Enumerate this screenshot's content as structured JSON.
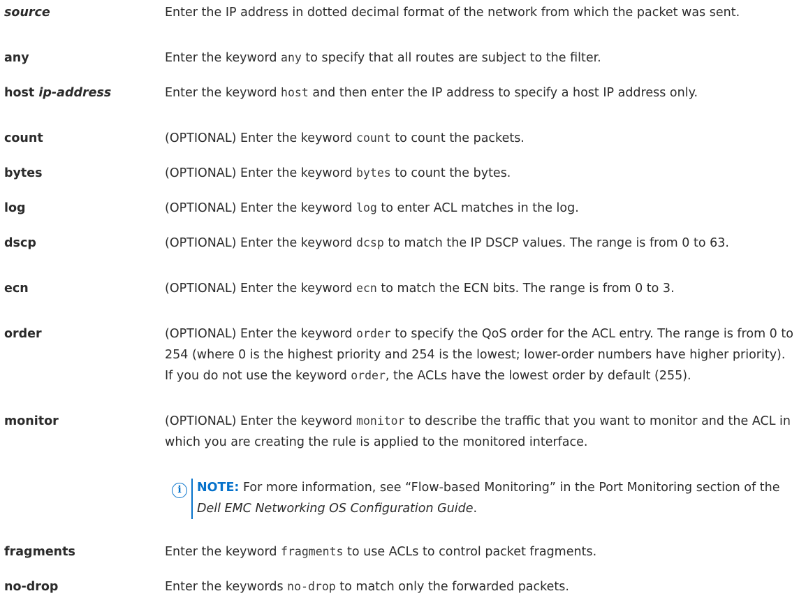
{
  "entries": [
    {
      "term": "source",
      "desc": [
        "Enter the IP address in dotted decimal format of the network from which the packet was sent."
      ]
    },
    {
      "term": "any",
      "desc": [
        "Enter the keyword ",
        "any",
        " to specify that all routes are subject to the filter."
      ]
    },
    {
      "term_bold": "host ",
      "term_italic": "ip-address",
      "desc": [
        "Enter the keyword ",
        "host",
        " and then enter the IP address to specify a host IP address only."
      ]
    },
    {
      "term": "count",
      "desc": [
        "(OPTIONAL) Enter the keyword ",
        "count",
        " to count the packets."
      ]
    },
    {
      "term": "bytes",
      "desc": [
        "(OPTIONAL) Enter the keyword ",
        "bytes",
        " to count the bytes."
      ]
    },
    {
      "term": "log",
      "desc": [
        "(OPTIONAL) Enter the keyword ",
        "log",
        " to enter ACL matches in the log."
      ]
    },
    {
      "term": "dscp",
      "desc": [
        "(OPTIONAL) Enter the keyword ",
        "dcsp",
        " to match the IP DSCP values. The range is from 0 to 63."
      ]
    },
    {
      "term": "ecn",
      "desc": [
        "(OPTIONAL) Enter the keyword ",
        "ecn",
        " to match the ECN bits. The range is from 0 to 3."
      ]
    },
    {
      "term": "order",
      "desc": [
        "(OPTIONAL) Enter the keyword ",
        "order",
        " to specify the QoS order for the ACL entry. The range is from 0 to 254 (where 0 is the highest priority and 254 is the lowest; lower-order numbers have higher priority). If you do not use the keyword ",
        "order",
        ", the ACLs have the lowest order by default (255)."
      ]
    },
    {
      "term": "monitor",
      "desc": [
        "(OPTIONAL) Enter the keyword ",
        "monitor",
        " to describe the traffic that you want to monitor and the ACL in which you are creating the rule is applied to the monitored interface."
      ]
    },
    {
      "term": "fragments",
      "desc": [
        "Enter the keyword ",
        "fragments",
        " to use ACLs to control packet fragments."
      ]
    },
    {
      "term": "no-drop",
      "desc": [
        "Enter the keywords ",
        "no-drop",
        " to match only the forwarded packets."
      ]
    }
  ],
  "note": {
    "label": "NOTE:",
    "text_before": " For more information, see “Flow-based Monitoring” in the Port Monitoring section of the ",
    "guide_title": "Dell EMC Networking OS Configuration Guide",
    "text_after": "."
  },
  "colors": {
    "note_accent": "#0672cb",
    "text": "#2b2b2b"
  }
}
